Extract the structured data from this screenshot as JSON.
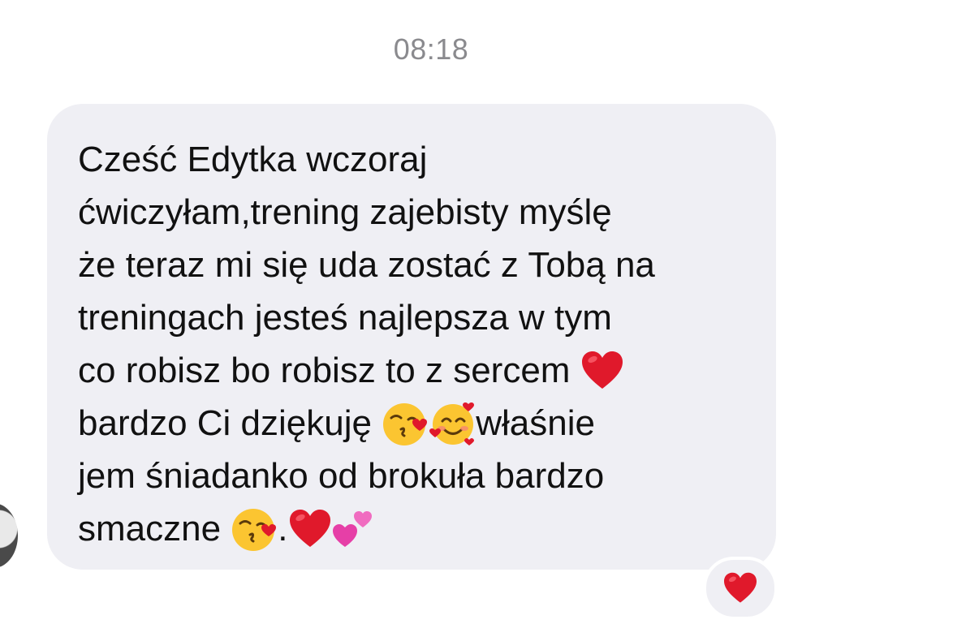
{
  "chat": {
    "timestamp": "08:18",
    "message": {
      "line1": "Cześć Edytka wczoraj",
      "line2": "ćwiczyłam,trening zajebisty myślę",
      "line3": "że teraz mi się uda zostać z Tobą na",
      "line4": "treningach jesteś najlepsza w tym",
      "line5_text": "co robisz bo robisz to z sercem ",
      "line6_text_a": "bardzo Ci dziękuję ",
      "line6_text_b": "właśnie",
      "line7": "jem śniadanko od brokuła bardzo",
      "line8_text_a": "smaczne ",
      "line8_text_b": "."
    },
    "reaction": {
      "icon": "red-heart-icon"
    }
  },
  "colors": {
    "bubble": "#efeff4",
    "text": "#111111",
    "timestamp": "#8a8a8e",
    "heart": "#e0192b"
  }
}
